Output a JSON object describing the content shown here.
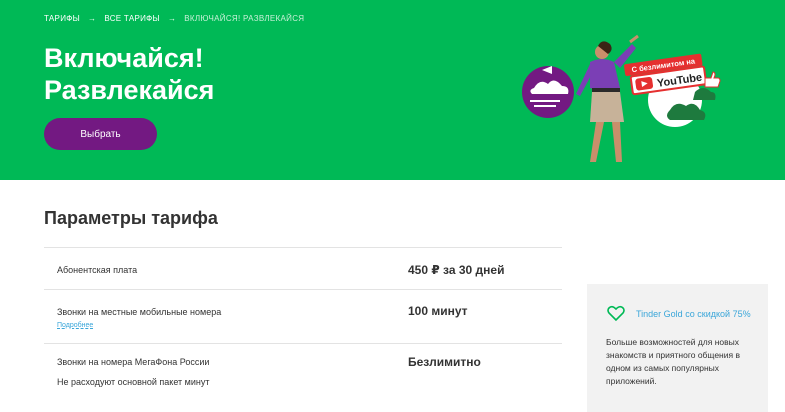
{
  "breadcrumbs": [
    "ТАРИФЫ",
    "ВСЕ ТАРИФЫ",
    "ВКЛЮЧАЙСЯ! РАЗВЛЕКАЙСЯ"
  ],
  "hero": {
    "title_line1": "Включайся!",
    "title_line2": "Развлекайся",
    "button": "Выбрать",
    "sticker": "С безлимитом на",
    "brand": "YouTube"
  },
  "params": {
    "title": "Параметры тарифа",
    "rows": [
      {
        "name": "Абонентская плата",
        "value": "450 ₽ за 30 дней"
      },
      {
        "name": "Звонки на местные мобильные номера",
        "value": "100 минут",
        "link": "Подробнее"
      },
      {
        "name": "Звонки на номера МегаФона России",
        "value": "Безлимитно",
        "note": "Не расходуют основной пакет минут"
      }
    ]
  },
  "promo": {
    "title": "Tinder Gold со скидкой 75%",
    "text": "Больше возможностей для новых знакомств и приятного общения в одном из самых популярных приложений."
  },
  "colors": {
    "green": "#00b956",
    "purple": "#731982",
    "link": "#3aa6d9"
  }
}
